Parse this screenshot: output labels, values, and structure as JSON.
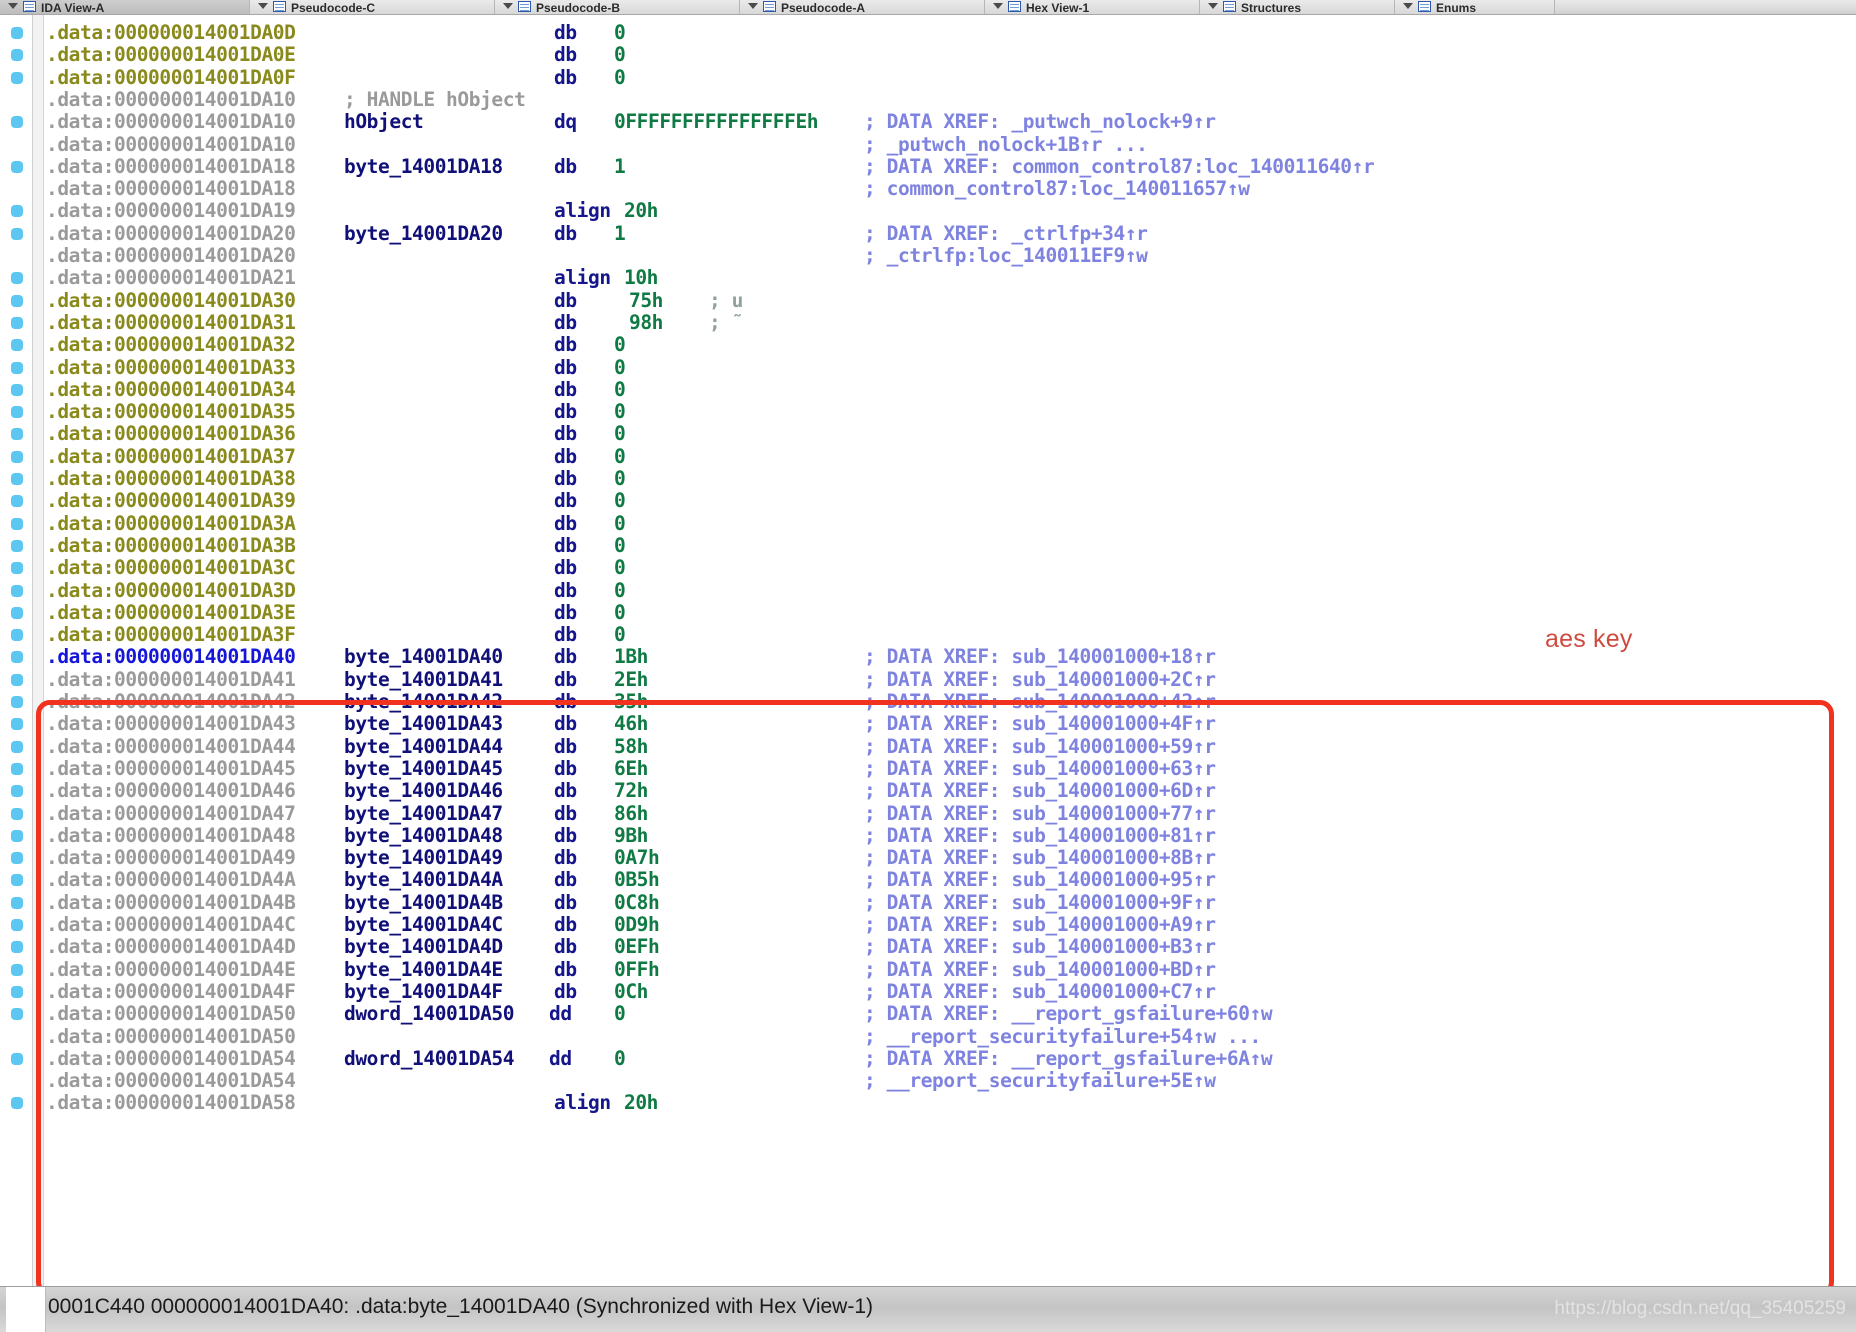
{
  "window": {
    "title": "IDA View-A",
    "tabs": [
      {
        "label": "IDA View-A",
        "active": true
      },
      {
        "label": "Pseudocode-C",
        "active": false
      },
      {
        "label": "Pseudocode-B",
        "active": false
      },
      {
        "label": "Pseudocode-A",
        "active": false
      },
      {
        "label": "Hex View-1",
        "active": false
      },
      {
        "label": "Structures",
        "active": false
      },
      {
        "label": "Enums",
        "active": false
      }
    ]
  },
  "annotation": {
    "aes_key_label": "aes key",
    "box_color": "#f0321e",
    "label_color": "#cf4b40"
  },
  "statusbar": {
    "text": "0001C440  000000014001DA40: .data:byte_14001DA40  (Synchronized with Hex View-1)",
    "watermark": "https://blog.csdn.net/qq_35405259"
  },
  "colors": {
    "address_olive": "#8a8a1c",
    "address_gray": "#9a9a9a",
    "address_current": "#1616d8",
    "name": "#101078",
    "mnemonic": "#15158c",
    "value": "#0f7a43",
    "comment_gray": "#9a9a9a",
    "xref": "#7f83e0",
    "gutter_dot": "#5cc8f2"
  },
  "disassembly": {
    "segment": ".data",
    "lines": [
      {
        "addr": ".data:000000014001DA0D",
        "addr_style": "olive",
        "dot": true,
        "name": "",
        "mnem": "db",
        "value": "0",
        "cmt": "",
        "cmt_style": ""
      },
      {
        "addr": ".data:000000014001DA0E",
        "addr_style": "olive",
        "dot": true,
        "name": "",
        "mnem": "db",
        "value": "0",
        "cmt": "",
        "cmt_style": ""
      },
      {
        "addr": ".data:000000014001DA0F",
        "addr_style": "olive",
        "dot": true,
        "name": "",
        "mnem": "db",
        "value": "0",
        "cmt": "",
        "cmt_style": ""
      },
      {
        "addr": ".data:000000014001DA10",
        "addr_style": "gray",
        "dot": false,
        "name": "",
        "mnem": "",
        "value": "",
        "cmt": "; HANDLE hObject",
        "cmt_style": "gray",
        "cmt_inline": true
      },
      {
        "addr": ".data:000000014001DA10",
        "addr_style": "gray",
        "dot": true,
        "name": "hObject",
        "mnem": "dq",
        "value": "0FFFFFFFFFFFFFFFEh",
        "cmt": "; DATA XREF: _putwch_nolock+9↑r",
        "cmt_style": "xref"
      },
      {
        "addr": ".data:000000014001DA10",
        "addr_style": "gray",
        "dot": false,
        "name": "",
        "mnem": "",
        "value": "",
        "cmt": "; _putwch_nolock+1B↑r ...",
        "cmt_style": "xref"
      },
      {
        "addr": ".data:000000014001DA18",
        "addr_style": "gray",
        "dot": true,
        "name": "byte_14001DA18",
        "mnem": "db",
        "value": "1",
        "cmt": "; DATA XREF: common_control87:loc_140011640↑r",
        "cmt_style": "xref"
      },
      {
        "addr": ".data:000000014001DA18",
        "addr_style": "gray",
        "dot": false,
        "name": "",
        "mnem": "",
        "value": "",
        "cmt": "; common_control87:loc_140011657↑w",
        "cmt_style": "xref"
      },
      {
        "addr": ".data:000000014001DA19",
        "addr_style": "gray",
        "dot": true,
        "name": "",
        "mnem": "align",
        "value": "20h",
        "cmt": "",
        "cmt_style": "",
        "align_line": true
      },
      {
        "addr": ".data:000000014001DA20",
        "addr_style": "gray",
        "dot": true,
        "name": "byte_14001DA20",
        "mnem": "db",
        "value": "1",
        "cmt": "; DATA XREF: _ctrlfp+34↑r",
        "cmt_style": "xref"
      },
      {
        "addr": ".data:000000014001DA20",
        "addr_style": "gray",
        "dot": false,
        "name": "",
        "mnem": "",
        "value": "",
        "cmt": "; _ctrlfp:loc_140011EF9↑w",
        "cmt_style": "xref"
      },
      {
        "addr": ".data:000000014001DA21",
        "addr_style": "gray",
        "dot": true,
        "name": "",
        "mnem": "align",
        "value": "10h",
        "cmt": "",
        "cmt_style": "",
        "align_line": true
      },
      {
        "addr": ".data:000000014001DA30",
        "addr_style": "olive",
        "dot": true,
        "name": "",
        "mnem": "db",
        "value": "75h",
        "cmt": "; u",
        "cmt_style": "semi",
        "val_offset": true
      },
      {
        "addr": ".data:000000014001DA31",
        "addr_style": "olive",
        "dot": true,
        "name": "",
        "mnem": "db",
        "value": "98h",
        "cmt": "; ˜",
        "cmt_style": "semi",
        "val_offset": true
      },
      {
        "addr": ".data:000000014001DA32",
        "addr_style": "olive",
        "dot": true,
        "name": "",
        "mnem": "db",
        "value": "0",
        "cmt": "",
        "cmt_style": ""
      },
      {
        "addr": ".data:000000014001DA33",
        "addr_style": "olive",
        "dot": true,
        "name": "",
        "mnem": "db",
        "value": "0",
        "cmt": "",
        "cmt_style": ""
      },
      {
        "addr": ".data:000000014001DA34",
        "addr_style": "olive",
        "dot": true,
        "name": "",
        "mnem": "db",
        "value": "0",
        "cmt": "",
        "cmt_style": ""
      },
      {
        "addr": ".data:000000014001DA35",
        "addr_style": "olive",
        "dot": true,
        "name": "",
        "mnem": "db",
        "value": "0",
        "cmt": "",
        "cmt_style": ""
      },
      {
        "addr": ".data:000000014001DA36",
        "addr_style": "olive",
        "dot": true,
        "name": "",
        "mnem": "db",
        "value": "0",
        "cmt": "",
        "cmt_style": ""
      },
      {
        "addr": ".data:000000014001DA37",
        "addr_style": "olive",
        "dot": true,
        "name": "",
        "mnem": "db",
        "value": "0",
        "cmt": "",
        "cmt_style": ""
      },
      {
        "addr": ".data:000000014001DA38",
        "addr_style": "olive",
        "dot": true,
        "name": "",
        "mnem": "db",
        "value": "0",
        "cmt": "",
        "cmt_style": ""
      },
      {
        "addr": ".data:000000014001DA39",
        "addr_style": "olive",
        "dot": true,
        "name": "",
        "mnem": "db",
        "value": "0",
        "cmt": "",
        "cmt_style": ""
      },
      {
        "addr": ".data:000000014001DA3A",
        "addr_style": "olive",
        "dot": true,
        "name": "",
        "mnem": "db",
        "value": "0",
        "cmt": "",
        "cmt_style": ""
      },
      {
        "addr": ".data:000000014001DA3B",
        "addr_style": "olive",
        "dot": true,
        "name": "",
        "mnem": "db",
        "value": "0",
        "cmt": "",
        "cmt_style": ""
      },
      {
        "addr": ".data:000000014001DA3C",
        "addr_style": "olive",
        "dot": true,
        "name": "",
        "mnem": "db",
        "value": "0",
        "cmt": "",
        "cmt_style": ""
      },
      {
        "addr": ".data:000000014001DA3D",
        "addr_style": "olive",
        "dot": true,
        "name": "",
        "mnem": "db",
        "value": "0",
        "cmt": "",
        "cmt_style": ""
      },
      {
        "addr": ".data:000000014001DA3E",
        "addr_style": "olive",
        "dot": true,
        "name": "",
        "mnem": "db",
        "value": "0",
        "cmt": "",
        "cmt_style": ""
      },
      {
        "addr": ".data:000000014001DA3F",
        "addr_style": "olive",
        "dot": true,
        "name": "",
        "mnem": "db",
        "value": "0",
        "cmt": "",
        "cmt_style": ""
      },
      {
        "addr": ".data:000000014001DA40",
        "addr_style": "blue",
        "dot": true,
        "name": "byte_14001DA40",
        "mnem": "db",
        "value": "1Bh",
        "cmt": "; DATA XREF: sub_140001000+18↑r",
        "cmt_style": "xref"
      },
      {
        "addr": ".data:000000014001DA41",
        "addr_style": "gray",
        "dot": true,
        "name": "byte_14001DA41",
        "mnem": "db",
        "value": "2Eh",
        "cmt": "; DATA XREF: sub_140001000+2C↑r",
        "cmt_style": "xref"
      },
      {
        "addr": ".data:000000014001DA42",
        "addr_style": "gray",
        "dot": true,
        "name": "byte_14001DA42",
        "mnem": "db",
        "value": "35h",
        "cmt": "; DATA XREF: sub_140001000+42↑r",
        "cmt_style": "xref"
      },
      {
        "addr": ".data:000000014001DA43",
        "addr_style": "gray",
        "dot": true,
        "name": "byte_14001DA43",
        "mnem": "db",
        "value": "46h",
        "cmt": "; DATA XREF: sub_140001000+4F↑r",
        "cmt_style": "xref"
      },
      {
        "addr": ".data:000000014001DA44",
        "addr_style": "gray",
        "dot": true,
        "name": "byte_14001DA44",
        "mnem": "db",
        "value": "58h",
        "cmt": "; DATA XREF: sub_140001000+59↑r",
        "cmt_style": "xref"
      },
      {
        "addr": ".data:000000014001DA45",
        "addr_style": "gray",
        "dot": true,
        "name": "byte_14001DA45",
        "mnem": "db",
        "value": "6Eh",
        "cmt": "; DATA XREF: sub_140001000+63↑r",
        "cmt_style": "xref"
      },
      {
        "addr": ".data:000000014001DA46",
        "addr_style": "gray",
        "dot": true,
        "name": "byte_14001DA46",
        "mnem": "db",
        "value": "72h",
        "cmt": "; DATA XREF: sub_140001000+6D↑r",
        "cmt_style": "xref"
      },
      {
        "addr": ".data:000000014001DA47",
        "addr_style": "gray",
        "dot": true,
        "name": "byte_14001DA47",
        "mnem": "db",
        "value": "86h",
        "cmt": "; DATA XREF: sub_140001000+77↑r",
        "cmt_style": "xref"
      },
      {
        "addr": ".data:000000014001DA48",
        "addr_style": "gray",
        "dot": true,
        "name": "byte_14001DA48",
        "mnem": "db",
        "value": "9Bh",
        "cmt": "; DATA XREF: sub_140001000+81↑r",
        "cmt_style": "xref"
      },
      {
        "addr": ".data:000000014001DA49",
        "addr_style": "gray",
        "dot": true,
        "name": "byte_14001DA49",
        "mnem": "db",
        "value": "0A7h",
        "cmt": "; DATA XREF: sub_140001000+8B↑r",
        "cmt_style": "xref"
      },
      {
        "addr": ".data:000000014001DA4A",
        "addr_style": "gray",
        "dot": true,
        "name": "byte_14001DA4A",
        "mnem": "db",
        "value": "0B5h",
        "cmt": "; DATA XREF: sub_140001000+95↑r",
        "cmt_style": "xref"
      },
      {
        "addr": ".data:000000014001DA4B",
        "addr_style": "gray",
        "dot": true,
        "name": "byte_14001DA4B",
        "mnem": "db",
        "value": "0C8h",
        "cmt": "; DATA XREF: sub_140001000+9F↑r",
        "cmt_style": "xref"
      },
      {
        "addr": ".data:000000014001DA4C",
        "addr_style": "gray",
        "dot": true,
        "name": "byte_14001DA4C",
        "mnem": "db",
        "value": "0D9h",
        "cmt": "; DATA XREF: sub_140001000+A9↑r",
        "cmt_style": "xref"
      },
      {
        "addr": ".data:000000014001DA4D",
        "addr_style": "gray",
        "dot": true,
        "name": "byte_14001DA4D",
        "mnem": "db",
        "value": "0EFh",
        "cmt": "; DATA XREF: sub_140001000+B3↑r",
        "cmt_style": "xref"
      },
      {
        "addr": ".data:000000014001DA4E",
        "addr_style": "gray",
        "dot": true,
        "name": "byte_14001DA4E",
        "mnem": "db",
        "value": "0FFh",
        "cmt": "; DATA XREF: sub_140001000+BD↑r",
        "cmt_style": "xref"
      },
      {
        "addr": ".data:000000014001DA4F",
        "addr_style": "gray",
        "dot": true,
        "name": "byte_14001DA4F",
        "mnem": "db",
        "value": "0Ch",
        "cmt": "; DATA XREF: sub_140001000+C7↑r",
        "cmt_style": "xref"
      },
      {
        "addr": ".data:000000014001DA50",
        "addr_style": "gray",
        "dot": true,
        "name": "dword_14001DA50",
        "mnem": "dd",
        "value": "0",
        "cmt": "; DATA XREF: __report_gsfailure+60↑w",
        "cmt_style": "xref",
        "dd_line": true
      },
      {
        "addr": ".data:000000014001DA50",
        "addr_style": "gray",
        "dot": false,
        "name": "",
        "mnem": "",
        "value": "",
        "cmt": "; __report_securityfailure+54↑w ...",
        "cmt_style": "xref"
      },
      {
        "addr": ".data:000000014001DA54",
        "addr_style": "gray",
        "dot": true,
        "name": "dword_14001DA54",
        "mnem": "dd",
        "value": "0",
        "cmt": "; DATA XREF: __report_gsfailure+6A↑w",
        "cmt_style": "xref",
        "dd_line": true
      },
      {
        "addr": ".data:000000014001DA54",
        "addr_style": "gray",
        "dot": false,
        "name": "",
        "mnem": "",
        "value": "",
        "cmt": "; __report_securityfailure+5E↑w",
        "cmt_style": "xref"
      },
      {
        "addr": ".data:000000014001DA58",
        "addr_style": "gray",
        "dot": true,
        "name": "",
        "mnem": "align",
        "value": "20h",
        "cmt": "",
        "cmt_style": "",
        "align_line": true
      }
    ]
  }
}
